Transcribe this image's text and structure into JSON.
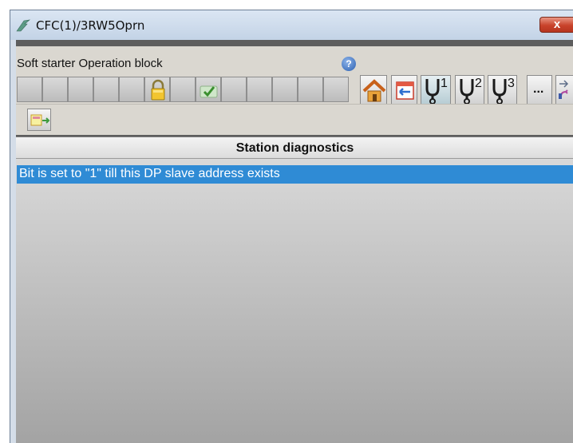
{
  "window": {
    "title": "CFC(1)/3RW5Oprn",
    "icons": {
      "app": "faceplate-app-icon",
      "close": "close-icon"
    },
    "close_label": "x"
  },
  "faceplate": {
    "block_title": "Soft starter Operation block",
    "help_label": "?",
    "status_cells": [
      {
        "icon": null
      },
      {
        "icon": null
      },
      {
        "icon": null
      },
      {
        "icon": null
      },
      {
        "icon": null
      },
      {
        "icon": "padlock-icon"
      },
      {
        "icon": null
      },
      {
        "icon": "checkmark-icon"
      },
      {
        "icon": null
      },
      {
        "icon": null
      },
      {
        "icon": null
      },
      {
        "icon": null
      },
      {
        "icon": null
      }
    ],
    "toolbar": {
      "home_icon": "home-icon",
      "trend_icon": "return-icon",
      "diag1_label": "1",
      "diag2_label": "2",
      "diag3_label": "3",
      "more_label": "...",
      "selected": "diagnostics-1"
    },
    "nav": {
      "icon": "next-view-icon"
    }
  },
  "station_diagnostics": {
    "heading": "Station diagnostics",
    "items": [
      {
        "text": "Bit is set to \"1\" till this DP slave address exists",
        "selected": true
      }
    ]
  },
  "colors": {
    "selection": "#2f8bd5",
    "titlebar": "#c8d7ea",
    "close": "#c8432b",
    "faceplate_band": "#dad7d0"
  }
}
